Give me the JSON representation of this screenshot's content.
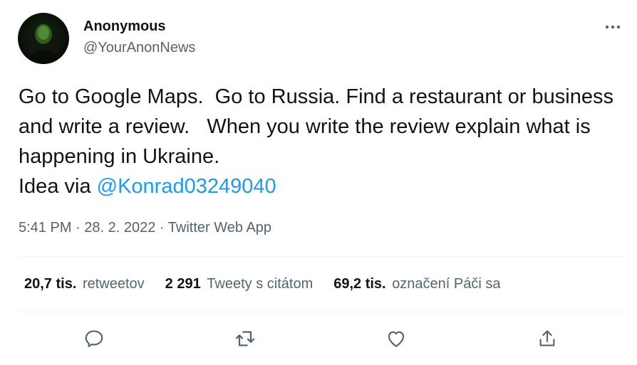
{
  "tweet": {
    "author": {
      "name": "Anonymous",
      "handle": "@YourAnonNews"
    },
    "text_before_mention": "Go to Google Maps.  Go to Russia. Find a restaurant or business and write a review.   When you write the review explain what is happening in Ukraine.\nIdea via ",
    "mention": "@Konrad03249040",
    "time": "5:41 PM",
    "separator": " · ",
    "date": "28. 2. 2022",
    "source": "Twitter Web App"
  },
  "stats": {
    "retweets": {
      "value": "20,7 tis.",
      "label": "retweetov"
    },
    "quotes": {
      "value": "2 291",
      "label": "Tweety s citátom"
    },
    "likes": {
      "value": "69,2 tis.",
      "label": "označení Páči sa"
    }
  },
  "icons": {
    "more": "more-horizontal-icon",
    "reply": "reply-icon",
    "retweet": "retweet-icon",
    "like": "heart-icon",
    "share": "share-icon"
  },
  "colors": {
    "text": "#0f1419",
    "secondary": "#536471",
    "link": "#1d9bf0",
    "divider": "#eff3f4"
  }
}
